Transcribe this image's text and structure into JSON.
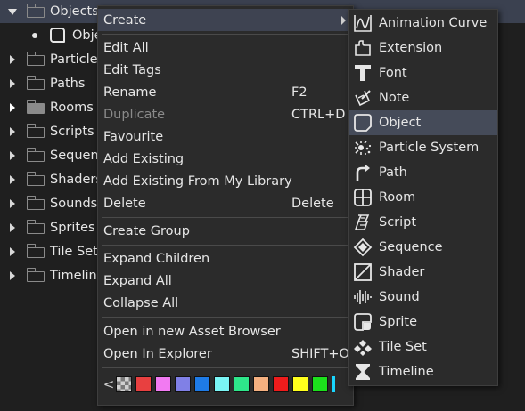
{
  "tree": {
    "items": [
      {
        "label": "Objects",
        "expanded": true,
        "selected": true
      },
      {
        "label": "Obje",
        "child": true
      },
      {
        "label": "Particle",
        "expanded": false
      },
      {
        "label": "Paths",
        "expanded": false
      },
      {
        "label": "Rooms",
        "expanded": false,
        "filled": true
      },
      {
        "label": "Scripts",
        "expanded": false
      },
      {
        "label": "Sequenc",
        "expanded": false
      },
      {
        "label": "Shaders",
        "expanded": false
      },
      {
        "label": "Sounds",
        "expanded": false
      },
      {
        "label": "Sprites",
        "expanded": false
      },
      {
        "label": "Tile Sets",
        "expanded": false
      },
      {
        "label": "Timeline",
        "expanded": false
      }
    ]
  },
  "context_menu": {
    "create": "Create",
    "edit_all": "Edit All",
    "edit_tags": "Edit Tags",
    "rename": "Rename",
    "rename_shortcut": "F2",
    "duplicate": "Duplicate",
    "duplicate_shortcut": "CTRL+D",
    "favourite": "Favourite",
    "add_existing": "Add Existing",
    "add_existing_library": "Add Existing From My Library",
    "delete": "Delete",
    "delete_shortcut": "Delete",
    "create_group": "Create Group",
    "expand_children": "Expand Children",
    "expand_all": "Expand All",
    "collapse_all": "Collapse All",
    "open_new_browser": "Open in new Asset Browser",
    "open_explorer": "Open In Explorer",
    "open_explorer_shortcut": "SHIFT+O",
    "color_prev": "<",
    "colors": [
      "#e84040",
      "#f27af2",
      "#8080e6",
      "#1e7be6",
      "#7af5f5",
      "#2ee68a",
      "#f5b080",
      "#ee1c1c",
      "#ffff1c",
      "#1ce01c"
    ]
  },
  "create_submenu": {
    "items": [
      {
        "label": "Animation Curve",
        "icon": "animation-curve-icon"
      },
      {
        "label": "Extension",
        "icon": "extension-icon"
      },
      {
        "label": "Font",
        "icon": "font-icon"
      },
      {
        "label": "Note",
        "icon": "note-icon"
      },
      {
        "label": "Object",
        "icon": "object-icon",
        "highlight": true
      },
      {
        "label": "Particle System",
        "icon": "particle-system-icon"
      },
      {
        "label": "Path",
        "icon": "path-icon"
      },
      {
        "label": "Room",
        "icon": "room-icon"
      },
      {
        "label": "Script",
        "icon": "script-icon"
      },
      {
        "label": "Sequence",
        "icon": "sequence-icon"
      },
      {
        "label": "Shader",
        "icon": "shader-icon"
      },
      {
        "label": "Sound",
        "icon": "sound-icon"
      },
      {
        "label": "Sprite",
        "icon": "sprite-icon"
      },
      {
        "label": "Tile Set",
        "icon": "tile-set-icon"
      },
      {
        "label": "Timeline",
        "icon": "timeline-icon"
      }
    ]
  }
}
